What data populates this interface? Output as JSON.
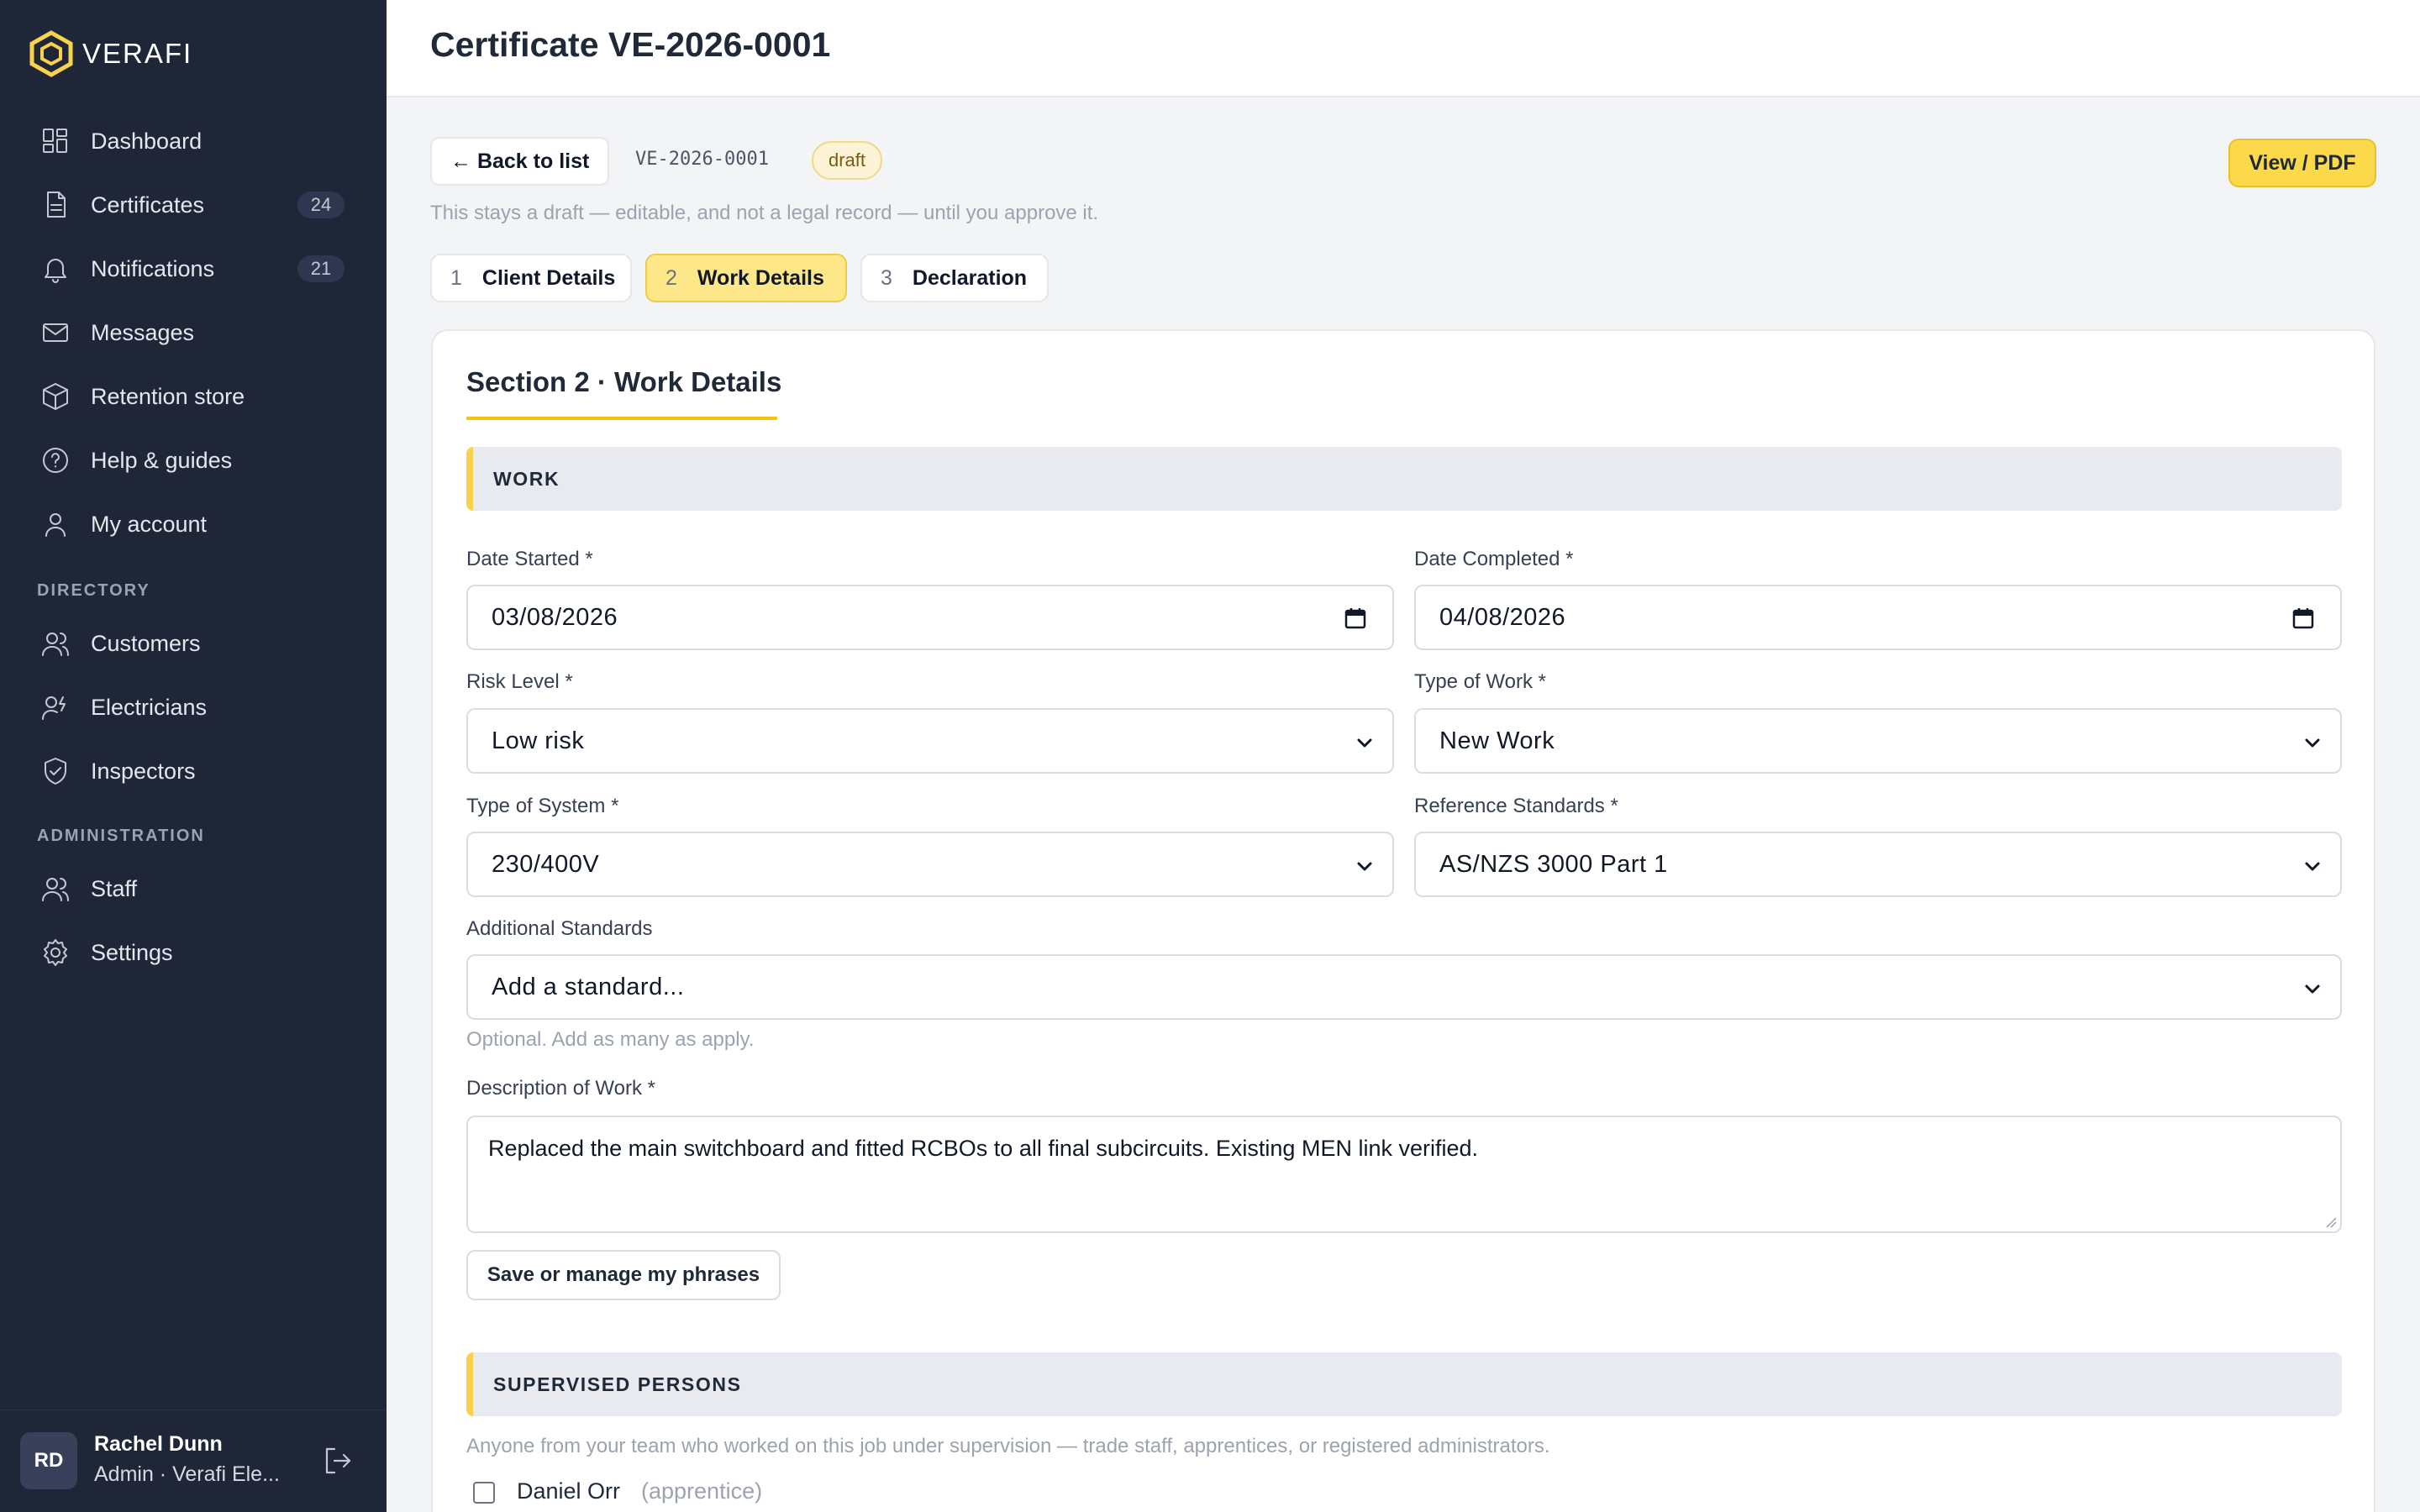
{
  "brand": {
    "name": "VERAFI",
    "accent": "#f7d24a"
  },
  "sidebar": {
    "items": [
      {
        "label": "Dashboard",
        "icon": "dashboard-icon"
      },
      {
        "label": "Certificates",
        "icon": "document-icon",
        "count": "24"
      },
      {
        "label": "Notifications",
        "icon": "bell-icon",
        "count": "21"
      },
      {
        "label": "Messages",
        "icon": "mail-icon"
      },
      {
        "label": "Retention store",
        "icon": "box-icon"
      },
      {
        "label": "Help & guides",
        "icon": "help-icon"
      },
      {
        "label": "My account",
        "icon": "user-icon"
      }
    ],
    "directory_heading": "DIRECTORY",
    "directory": [
      {
        "label": "Customers",
        "icon": "users-icon"
      },
      {
        "label": "Electricians",
        "icon": "electrician-icon"
      },
      {
        "label": "Inspectors",
        "icon": "shield-check-icon"
      }
    ],
    "admin_heading": "ADMINISTRATION",
    "admin": [
      {
        "label": "Staff",
        "icon": "staff-icon"
      },
      {
        "label": "Settings",
        "icon": "gear-icon"
      }
    ],
    "user": {
      "initials": "RD",
      "name": "Rachel Dunn",
      "role": "Admin · Verafi Ele..."
    }
  },
  "header": {
    "title": "Certificate VE-2026-0001"
  },
  "toolbar": {
    "back_label": "← Back to list",
    "code": "VE-2026-0001",
    "status": "draft",
    "pdf_label": "View / PDF",
    "note": "This stays a draft — editable, and not a legal record — until you approve it."
  },
  "steps": [
    {
      "num": "1",
      "label": "Client Details",
      "active": false
    },
    {
      "num": "2",
      "label": "Work Details",
      "active": true
    },
    {
      "num": "3",
      "label": "Declaration",
      "active": false
    }
  ],
  "section": {
    "title": "Section 2 · Work Details",
    "work_heading": "WORK",
    "date_started": {
      "label": "Date Started *",
      "value": "03/08/2026"
    },
    "date_completed": {
      "label": "Date Completed *",
      "value": "04/08/2026"
    },
    "risk_level": {
      "label": "Risk Level *",
      "value": "Low risk"
    },
    "type_of_work": {
      "label": "Type of Work *",
      "value": "New Work"
    },
    "type_of_system": {
      "label": "Type of System *",
      "value": "230/400V"
    },
    "reference_standards": {
      "label": "Reference Standards *",
      "value": "AS/NZS 3000 Part 1"
    },
    "additional_standards": {
      "label": "Additional Standards",
      "value": "Add a standard...",
      "help": "Optional. Add as many as apply."
    },
    "description": {
      "label": "Description of Work *",
      "value": "Replaced the main switchboard and fitted RCBOs to all final subcircuits. Existing MEN link verified."
    },
    "phrases_label": "Save or manage my phrases",
    "supervised_heading": "SUPERVISED PERSONS",
    "supervised_help": "Anyone from your team who worked on this job under supervision — trade staff, apprentices, or registered administrators.",
    "persons": [
      {
        "name": "Daniel Orr",
        "role": "(apprentice)",
        "checked": false
      }
    ]
  }
}
